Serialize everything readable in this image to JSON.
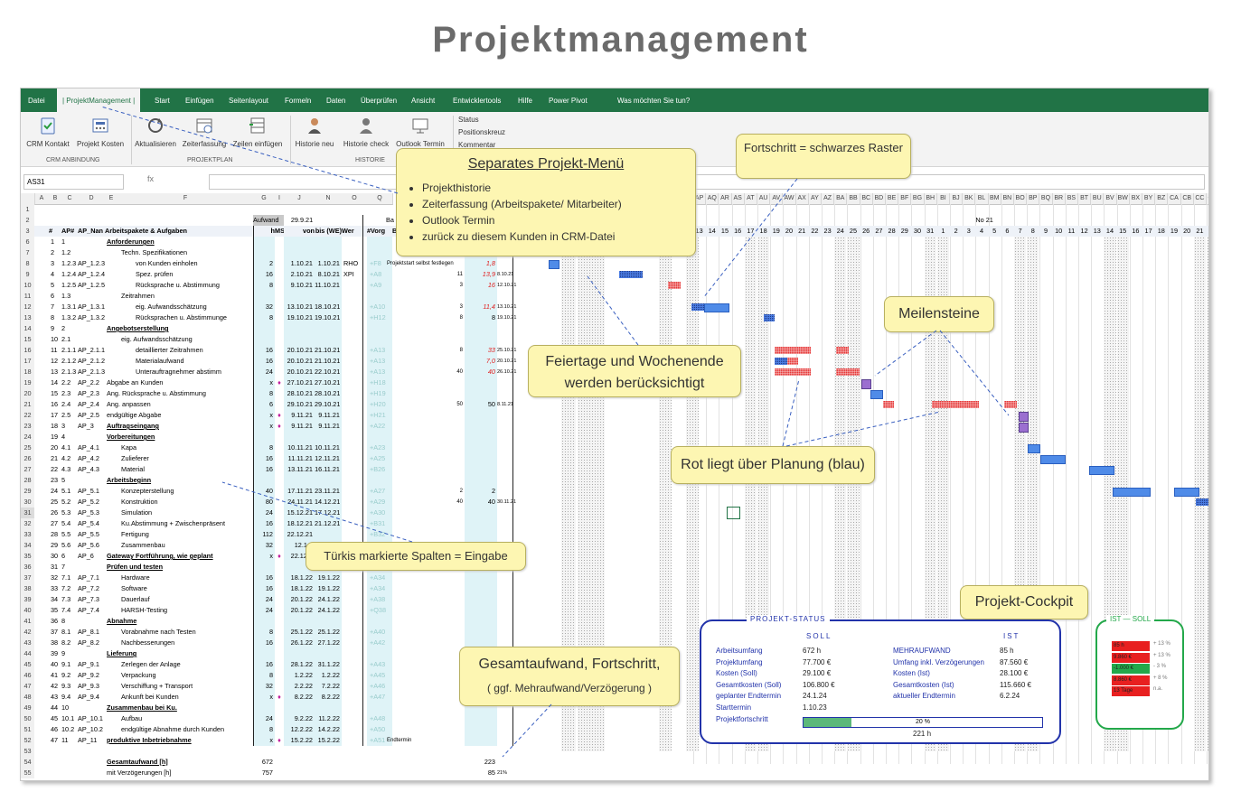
{
  "page_title": "Projektmanagement",
  "tabs": [
    "Datei",
    "| ProjektManagement |",
    "Start",
    "Einfügen",
    "Seitenlayout",
    "Formeln",
    "Daten",
    "Überprüfen",
    "Ansicht",
    "Entwicklertools",
    "Hilfe",
    "Power Pivot",
    "Was möchten Sie tun?"
  ],
  "ribbon": {
    "buttons": [
      "CRM Kontakt",
      "Projekt Kosten",
      "Aktualisieren",
      "Zeiterfassung",
      "Zeilen einfügen",
      "Historie neu",
      "Historie check",
      "Outlook Termin"
    ],
    "groups": [
      "CRM ANBINDUNG",
      "PROJEKTPLAN",
      "HISTORIE"
    ],
    "checks": [
      "Status",
      "Positionskreuz",
      "Kommentar"
    ]
  },
  "namebox": "AS31",
  "fx": "fx",
  "col_headers_left": [
    "A",
    "B",
    "C",
    "D",
    "E",
    "F",
    "G",
    "I",
    "J",
    "N",
    "O",
    "Q"
  ],
  "col_headers_right": [
    "AP",
    "AQ",
    "AR",
    "AS",
    "AT",
    "AU",
    "AV",
    "AW",
    "AX",
    "AY",
    "AZ",
    "BA",
    "BB",
    "BC",
    "BD",
    "BE",
    "BF",
    "BG",
    "BH",
    "BI",
    "BJ",
    "BK",
    "BL",
    "BM",
    "BN",
    "BO",
    "BP",
    "BQ",
    "BR",
    "BS",
    "BT",
    "BU",
    "BV",
    "BW",
    "BX",
    "BY",
    "BZ",
    "CA",
    "CB",
    "CC",
    "CD",
    "CE",
    "CF"
  ],
  "header_row2": {
    "aufwand": "Aufwand",
    "date": "29.9.21",
    "ba": "Ba",
    "month": "No 21"
  },
  "header_row3": {
    "nr": "#",
    "ap": "AP#",
    "apname": "AP_Nan",
    "task": "Arbeitspakete & Aufgaben",
    "h": "h",
    "ms": "MS",
    "von": "von",
    "bis": "bis (WE)",
    "wer": "Wer",
    "vorg": "#Vorg",
    "be": "Be"
  },
  "day_numbers": [
    "13",
    "14",
    "15",
    "16",
    "17",
    "18",
    "19",
    "20",
    "21",
    "22",
    "23",
    "24",
    "25",
    "26",
    "27",
    "28",
    "29",
    "30",
    "31",
    "1",
    "2",
    "3",
    "4",
    "5",
    "6",
    "7",
    "8",
    "9",
    "10",
    "11",
    "12",
    "13",
    "14",
    "15",
    "16",
    "17",
    "18",
    "19",
    "20",
    "21",
    "22",
    "23",
    "24"
  ],
  "rows": [
    {
      "r": "6",
      "a": "1",
      "b": "1",
      "c": "",
      "t": "Anforderungen",
      "h": "",
      "ms": "",
      "von": "",
      "bis": "",
      "wer": "",
      "vorg": "",
      "p": "",
      "v": "",
      "x": "",
      "hdr": true,
      "ind": 0
    },
    {
      "r": "7",
      "a": "2",
      "b": "1.2",
      "c": "",
      "t": "Techn. Spezifikationen",
      "h": "",
      "ms": "",
      "von": "",
      "bis": "",
      "wer": "",
      "vorg": "",
      "p": "",
      "v": "",
      "x": "",
      "ind": 1
    },
    {
      "r": "8",
      "a": "3",
      "b": "1.2.3",
      "c": "AP_1.2.3",
      "t": "von Kunden einholen",
      "h": "2",
      "ms": "",
      "von": "1.10.21",
      "bis": "1.10.21",
      "wer": "RHO",
      "vorg": "+F8",
      "p": "Projektstart selbst festlegen",
      "v": "1,8",
      "x": "",
      "ind": 2
    },
    {
      "r": "9",
      "a": "4",
      "b": "1.2.4",
      "c": "AP_1.2.4",
      "t": "Spez. prüfen",
      "h": "16",
      "ms": "",
      "von": "2.10.21",
      "bis": "8.10.21",
      "wer": "XPI",
      "vorg": "+A8",
      "p": "11",
      "v": "13,9",
      "x": "8.10.21",
      "ind": 2
    },
    {
      "r": "10",
      "a": "5",
      "b": "1.2.5",
      "c": "AP_1.2.5",
      "t": "Rücksprache u. Abstimmung",
      "h": "8",
      "ms": "",
      "von": "9.10.21",
      "bis": "11.10.21",
      "wer": "",
      "vorg": "+A9",
      "p": "3",
      "v": "16",
      "x": "12.10.21",
      "ind": 2
    },
    {
      "r": "11",
      "a": "6",
      "b": "1.3",
      "c": "",
      "t": "Zeitrahmen",
      "h": "",
      "ms": "",
      "von": "",
      "bis": "",
      "wer": "",
      "vorg": "",
      "p": "",
      "v": "",
      "x": "",
      "ind": 1
    },
    {
      "r": "12",
      "a": "7",
      "b": "1.3.1",
      "c": "AP_1.3.1",
      "t": "eig. Aufwandsschätzung",
      "h": "32",
      "ms": "",
      "von": "13.10.21",
      "bis": "18.10.21",
      "wer": "",
      "vorg": "+A10",
      "p": "3",
      "v": "11,4",
      "x": "13.10.21",
      "ind": 2
    },
    {
      "r": "13",
      "a": "8",
      "b": "1.3.2",
      "c": "AP_1.3.2",
      "t": "Rücksprachen u. Abstimmunge",
      "h": "8",
      "ms": "",
      "von": "19.10.21",
      "bis": "19.10.21",
      "wer": "",
      "vorg": "+H12",
      "p": "8",
      "v": "8",
      "x": "19.10.21",
      "ind": 2
    },
    {
      "r": "14",
      "a": "9",
      "b": "2",
      "c": "",
      "t": "Angebotserstellung",
      "h": "",
      "ms": "",
      "von": "",
      "bis": "",
      "wer": "",
      "vorg": "",
      "p": "",
      "v": "",
      "x": "",
      "hdr": true,
      "ind": 0
    },
    {
      "r": "15",
      "a": "10",
      "b": "2.1",
      "c": "",
      "t": "eig. Aufwandsschätzung",
      "h": "",
      "ms": "",
      "von": "",
      "bis": "",
      "wer": "",
      "vorg": "",
      "p": "",
      "v": "",
      "x": "",
      "ind": 1
    },
    {
      "r": "16",
      "a": "11",
      "b": "2.1.1",
      "c": "AP_2.1.1",
      "t": "detaillierter Zeitrahmen",
      "h": "16",
      "ms": "",
      "von": "20.10.21",
      "bis": "21.10.21",
      "wer": "",
      "vorg": "+A13",
      "p": "8",
      "v": "33",
      "x": "25.10.21",
      "ind": 2
    },
    {
      "r": "17",
      "a": "12",
      "b": "2.1.2",
      "c": "AP_2.1.2",
      "t": "Materialaufwand",
      "h": "16",
      "ms": "",
      "von": "20.10.21",
      "bis": "21.10.21",
      "wer": "",
      "vorg": "+A13",
      "p": "",
      "v": "7,0",
      "x": "20.10.21",
      "ind": 2
    },
    {
      "r": "18",
      "a": "13",
      "b": "2.1.3",
      "c": "AP_2.1.3",
      "t": "Unterauftragnehmer abstimm",
      "h": "24",
      "ms": "",
      "von": "20.10.21",
      "bis": "22.10.21",
      "wer": "",
      "vorg": "+A13",
      "p": "40",
      "v": "40",
      "x": "26.10.21",
      "ind": 2
    },
    {
      "r": "19",
      "a": "14",
      "b": "2.2",
      "c": "AP_2.2",
      "t": "Abgabe an Kunden",
      "h": "x",
      "ms": "♦",
      "von": "27.10.21",
      "bis": "27.10.21",
      "wer": "",
      "vorg": "+H18",
      "p": "",
      "v": "",
      "x": "",
      "ind": 0
    },
    {
      "r": "20",
      "a": "15",
      "b": "2.3",
      "c": "AP_2.3",
      "t": "Ang. Rücksprache u. Abstimmung",
      "h": "8",
      "ms": "",
      "von": "28.10.21",
      "bis": "28.10.21",
      "wer": "",
      "vorg": "+H19",
      "p": "",
      "v": "",
      "x": "",
      "ind": 0
    },
    {
      "r": "21",
      "a": "16",
      "b": "2.4",
      "c": "AP_2.4",
      "t": "Ang. anpassen",
      "h": "6",
      "ms": "",
      "von": "29.10.21",
      "bis": "29.10.21",
      "wer": "",
      "vorg": "+H20",
      "p": "50",
      "v": "50",
      "x": "8.11.21",
      "ind": 0
    },
    {
      "r": "22",
      "a": "17",
      "b": "2.5",
      "c": "AP_2.5",
      "t": "endgültige Abgabe",
      "h": "x",
      "ms": "♦",
      "von": "9.11.21",
      "bis": "9.11.21",
      "wer": "",
      "vorg": "+H21",
      "p": "",
      "v": "",
      "x": "",
      "ind": 0
    },
    {
      "r": "23",
      "a": "18",
      "b": "3",
      "c": "AP_3",
      "t": "Auftragseingang",
      "h": "x",
      "ms": "♦",
      "von": "9.11.21",
      "bis": "9.11.21",
      "wer": "",
      "vorg": "+A22",
      "p": "",
      "v": "",
      "x": "",
      "hdr": true,
      "ind": 0
    },
    {
      "r": "24",
      "a": "19",
      "b": "4",
      "c": "",
      "t": "Vorbereitungen",
      "h": "",
      "ms": "",
      "von": "",
      "bis": "",
      "wer": "",
      "vorg": "",
      "p": "",
      "v": "",
      "x": "",
      "hdr": true,
      "ind": 0
    },
    {
      "r": "25",
      "a": "20",
      "b": "4.1",
      "c": "AP_4.1",
      "t": "Kapa",
      "h": "8",
      "ms": "",
      "von": "10.11.21",
      "bis": "10.11.21",
      "wer": "",
      "vorg": "+A23",
      "p": "",
      "v": "",
      "x": "",
      "ind": 1
    },
    {
      "r": "26",
      "a": "21",
      "b": "4.2",
      "c": "AP_4.2",
      "t": "Zulieferer",
      "h": "16",
      "ms": "",
      "von": "11.11.21",
      "bis": "12.11.21",
      "wer": "",
      "vorg": "+A25",
      "p": "",
      "v": "",
      "x": "",
      "ind": 1
    },
    {
      "r": "27",
      "a": "22",
      "b": "4.3",
      "c": "AP_4.3",
      "t": "Material",
      "h": "16",
      "ms": "",
      "von": "13.11.21",
      "bis": "16.11.21",
      "wer": "",
      "vorg": "+B26",
      "p": "",
      "v": "",
      "x": "",
      "ind": 1
    },
    {
      "r": "28",
      "a": "23",
      "b": "5",
      "c": "",
      "t": "Arbeitsbeginn",
      "h": "",
      "ms": "",
      "von": "",
      "bis": "",
      "wer": "",
      "vorg": "",
      "p": "",
      "v": "",
      "x": "",
      "hdr": true,
      "ind": 0
    },
    {
      "r": "29",
      "a": "24",
      "b": "5.1",
      "c": "AP_5.1",
      "t": "Konzepterstellung",
      "h": "40",
      "ms": "",
      "von": "17.11.21",
      "bis": "23.11.21",
      "wer": "",
      "vorg": "+A27",
      "p": "2",
      "v": "2",
      "x": "",
      "ind": 1
    },
    {
      "r": "30",
      "a": "25",
      "b": "5.2",
      "c": "AP_5.2",
      "t": "Konstruktion",
      "h": "80",
      "ms": "",
      "von": "24.11.21",
      "bis": "14.12.21",
      "wer": "",
      "vorg": "+A29",
      "p": "40",
      "v": "40",
      "x": "30.11.21",
      "ind": 1
    },
    {
      "r": "31",
      "a": "26",
      "b": "5.3",
      "c": "AP_5.3",
      "t": "Simulation",
      "h": "24",
      "ms": "",
      "von": "15.12.21",
      "bis": "17.12.21",
      "wer": "",
      "vorg": "+A30",
      "p": "",
      "v": "",
      "x": "",
      "ind": 1,
      "sel": true
    },
    {
      "r": "32",
      "a": "27",
      "b": "5.4",
      "c": "AP_5.4",
      "t": "Ku.Abstimmung + Zwischenpräsent",
      "h": "16",
      "ms": "",
      "von": "18.12.21",
      "bis": "21.12.21",
      "wer": "",
      "vorg": "+B31",
      "p": "",
      "v": "",
      "x": "",
      "ind": 1
    },
    {
      "r": "33",
      "a": "28",
      "b": "5.5",
      "c": "AP_5.5",
      "t": "Fertigung",
      "h": "112",
      "ms": "",
      "von": "22.12.21",
      "bis": "",
      "wer": "",
      "vorg": "+B32",
      "p": "",
      "v": "",
      "x": "",
      "ind": 1
    },
    {
      "r": "34",
      "a": "29",
      "b": "5.6",
      "c": "AP_5.6",
      "t": "Zusammenbau",
      "h": "32",
      "ms": "",
      "von": "12.1.2",
      "bis": "",
      "wer": "",
      "vorg": "",
      "p": "",
      "v": "",
      "x": "",
      "ind": 1
    },
    {
      "r": "35",
      "a": "30",
      "b": "6",
      "c": "AP_6",
      "t": "Gateway Fortführung, wie geplant",
      "h": "x",
      "ms": "♦",
      "von": "22.12.2",
      "bis": "",
      "wer": "",
      "vorg": "",
      "p": "",
      "v": "",
      "x": "",
      "hdr": true,
      "ind": 0
    },
    {
      "r": "36",
      "a": "31",
      "b": "7",
      "c": "",
      "t": "Prüfen und testen",
      "h": "",
      "ms": "",
      "von": "",
      "bis": "",
      "wer": "",
      "vorg": "",
      "p": "",
      "v": "",
      "x": "",
      "hdr": true,
      "ind": 0
    },
    {
      "r": "37",
      "a": "32",
      "b": "7.1",
      "c": "AP_7.1",
      "t": "Hardware",
      "h": "16",
      "ms": "",
      "von": "18.1.22",
      "bis": "19.1.22",
      "wer": "",
      "vorg": "+A34",
      "p": "",
      "v": "",
      "x": "",
      "ind": 1
    },
    {
      "r": "38",
      "a": "33",
      "b": "7.2",
      "c": "AP_7.2",
      "t": "Software",
      "h": "16",
      "ms": "",
      "von": "18.1.22",
      "bis": "19.1.22",
      "wer": "",
      "vorg": "+A34",
      "p": "",
      "v": "",
      "x": "",
      "ind": 1
    },
    {
      "r": "39",
      "a": "34",
      "b": "7.3",
      "c": "AP_7.3",
      "t": "Dauerlauf",
      "h": "24",
      "ms": "",
      "von": "20.1.22",
      "bis": "24.1.22",
      "wer": "",
      "vorg": "+A38",
      "p": "",
      "v": "",
      "x": "",
      "ind": 1
    },
    {
      "r": "40",
      "a": "35",
      "b": "7.4",
      "c": "AP_7.4",
      "t": "HARSH-Testing",
      "h": "24",
      "ms": "",
      "von": "20.1.22",
      "bis": "24.1.22",
      "wer": "",
      "vorg": "+Q38",
      "p": "",
      "v": "",
      "x": "",
      "ind": 1
    },
    {
      "r": "41",
      "a": "36",
      "b": "8",
      "c": "",
      "t": "Abnahme",
      "h": "",
      "ms": "",
      "von": "",
      "bis": "",
      "wer": "",
      "vorg": "",
      "p": "",
      "v": "",
      "x": "",
      "hdr": true,
      "ind": 0
    },
    {
      "r": "42",
      "a": "37",
      "b": "8.1",
      "c": "AP_8.1",
      "t": "Vorabnahme nach Testen",
      "h": "8",
      "ms": "",
      "von": "25.1.22",
      "bis": "25.1.22",
      "wer": "",
      "vorg": "+A40",
      "p": "",
      "v": "",
      "x": "",
      "ind": 1
    },
    {
      "r": "43",
      "a": "38",
      "b": "8.2",
      "c": "AP_8.2",
      "t": "Nachbesserungen",
      "h": "16",
      "ms": "",
      "von": "26.1.22",
      "bis": "27.1.22",
      "wer": "",
      "vorg": "+A42",
      "p": "",
      "v": "",
      "x": "",
      "ind": 1
    },
    {
      "r": "44",
      "a": "39",
      "b": "9",
      "c": "",
      "t": "Lieferung",
      "h": "",
      "ms": "",
      "von": "",
      "bis": "",
      "wer": "",
      "vorg": "",
      "p": "",
      "v": "",
      "x": "",
      "hdr": true,
      "ind": 0
    },
    {
      "r": "45",
      "a": "40",
      "b": "9.1",
      "c": "AP_9.1",
      "t": "Zerlegen der Anlage",
      "h": "16",
      "ms": "",
      "von": "28.1.22",
      "bis": "31.1.22",
      "wer": "",
      "vorg": "+A43",
      "p": "",
      "v": "",
      "x": "",
      "ind": 1
    },
    {
      "r": "46",
      "a": "41",
      "b": "9.2",
      "c": "AP_9.2",
      "t": "Verpackung",
      "h": "8",
      "ms": "",
      "von": "1.2.22",
      "bis": "1.2.22",
      "wer": "",
      "vorg": "+A45",
      "p": "",
      "v": "",
      "x": "",
      "ind": 1
    },
    {
      "r": "47",
      "a": "42",
      "b": "9.3",
      "c": "AP_9.3",
      "t": "Verschiffung + Transport",
      "h": "32",
      "ms": "",
      "von": "2.2.22",
      "bis": "7.2.22",
      "wer": "",
      "vorg": "+A46",
      "p": "",
      "v": "",
      "x": "",
      "ind": 1
    },
    {
      "r": "48",
      "a": "43",
      "b": "9.4",
      "c": "AP_9.4",
      "t": "Ankunft bei Kunden",
      "h": "x",
      "ms": "♦",
      "von": "8.2.22",
      "bis": "8.2.22",
      "wer": "",
      "vorg": "+A47",
      "p": "",
      "v": "",
      "x": "",
      "ind": 1
    },
    {
      "r": "49",
      "a": "44",
      "b": "10",
      "c": "",
      "t": "Zusammenbau bei Ku.",
      "h": "",
      "ms": "",
      "von": "",
      "bis": "",
      "wer": "",
      "vorg": "",
      "p": "",
      "v": "",
      "x": "",
      "hdr": true,
      "ind": 0
    },
    {
      "r": "50",
      "a": "45",
      "b": "10.1",
      "c": "AP_10.1",
      "t": "Aufbau",
      "h": "24",
      "ms": "",
      "von": "9.2.22",
      "bis": "11.2.22",
      "wer": "",
      "vorg": "+A48",
      "p": "",
      "v": "",
      "x": "",
      "ind": 1
    },
    {
      "r": "51",
      "a": "46",
      "b": "10.2",
      "c": "AP_10.2",
      "t": "endgültige Abnahme durch Kunden",
      "h": "8",
      "ms": "",
      "von": "12.2.22",
      "bis": "14.2.22",
      "wer": "",
      "vorg": "+A50",
      "p": "",
      "v": "",
      "x": "",
      "ind": 1
    },
    {
      "r": "52",
      "a": "47",
      "b": "11",
      "c": "AP_11",
      "t": "produktive Inbetriebnahme",
      "h": "x",
      "ms": "♦",
      "von": "15.2.22",
      "bis": "15.2.22",
      "wer": "",
      "vorg": "+A51",
      "p": "Endtermin",
      "v": "",
      "x": "",
      "hdr": true,
      "ind": 0
    },
    {
      "r": "53",
      "a": "",
      "b": "",
      "c": "",
      "t": "",
      "h": "",
      "ms": "",
      "von": "",
      "bis": "",
      "wer": "",
      "vorg": "",
      "p": "",
      "v": "",
      "x": "",
      "ind": 0
    },
    {
      "r": "54",
      "a": "",
      "b": "",
      "c": "",
      "t": "Gesamtaufwand [h]",
      "h": "672",
      "ms": "",
      "von": "",
      "bis": "",
      "wer": "",
      "vorg": "",
      "p": "",
      "v": "223",
      "x": "",
      "hdr": true,
      "ind": 0
    },
    {
      "r": "55",
      "a": "",
      "b": "",
      "c": "",
      "t": "mit Verzögerungen [h]",
      "h": "757",
      "ms": "",
      "von": "",
      "bis": "",
      "wer": "",
      "vorg": "",
      "p": "",
      "v": "85",
      "x": "21%",
      "ind": 0
    }
  ],
  "cockpit": {
    "title": "PROJEKT-STATUS",
    "soll_header": "SOLL",
    "ist_header": "IST",
    "left": [
      {
        "label": "Arbeitsumfang",
        "value": "672 h"
      },
      {
        "label": "Projektumfang",
        "value": "77.700 €"
      },
      {
        "label": "Kosten (Soll)",
        "value": "29.100 €"
      },
      {
        "label": "Gesamtkosten (Soll)",
        "value": "106.800 €"
      },
      {
        "label": "geplanter Endtermin",
        "value": "24.1.24"
      },
      {
        "label": "Starttermin",
        "value": "1.10.23"
      },
      {
        "label": "Projektfortschritt",
        "value": ""
      }
    ],
    "right": [
      {
        "label": "MEHRAUFWAND",
        "value": "85 h"
      },
      {
        "label": "Umfang inkl. Verzögerungen",
        "value": "87.560 €"
      },
      {
        "label": "Kosten (Ist)",
        "value": "28.100 €"
      },
      {
        "label": "Gesamtkosten (Ist)",
        "value": "115.660 €"
      },
      {
        "label": "aktueller Endtermin",
        "value": "6.2.24"
      }
    ],
    "progress_label": "20 %",
    "progress_fraction": 0.2,
    "hours": "221 h"
  },
  "ist_soll": {
    "title": "IST — SOLL",
    "rows": [
      {
        "cell": "85 h",
        "pct": "+ 13 %",
        "color": "#e82020"
      },
      {
        "cell": "9.860 €",
        "pct": "+ 13 %",
        "color": "#e82020"
      },
      {
        "cell": "-1.000 €",
        "pct": "- 3 %",
        "color": "#23a84a"
      },
      {
        "cell": "8.860 €",
        "pct": "+ 8 %",
        "color": "#e82020"
      },
      {
        "cell": "13 Tage",
        "pct": "n.a.",
        "color": "#e82020"
      }
    ]
  },
  "notes": {
    "menu_title": "Separates Projekt-Menü",
    "menu_items": [
      "Projekthistorie",
      "Zeiterfassung (Arbeitspakete/ Mitarbeiter)",
      "Outlook Termin",
      "zurück zu diesem Kunden in CRM-Datei"
    ],
    "fortschritt": "Fortschritt = schwarzes Raster",
    "meilensteine": "Meilensteine",
    "feiertage": "Feiertage und Wochenende werden berücksichtigt",
    "rot": "Rot liegt über Planung (blau)",
    "tuerkis": "Türkis markierte Spalten = Eingabe",
    "cockpit": "Projekt-Cockpit",
    "gesamt1": "Gesamtaufwand, Fortschritt,",
    "gesamt2": "( ggf. Mehraufwand/Verzögerung )"
  }
}
